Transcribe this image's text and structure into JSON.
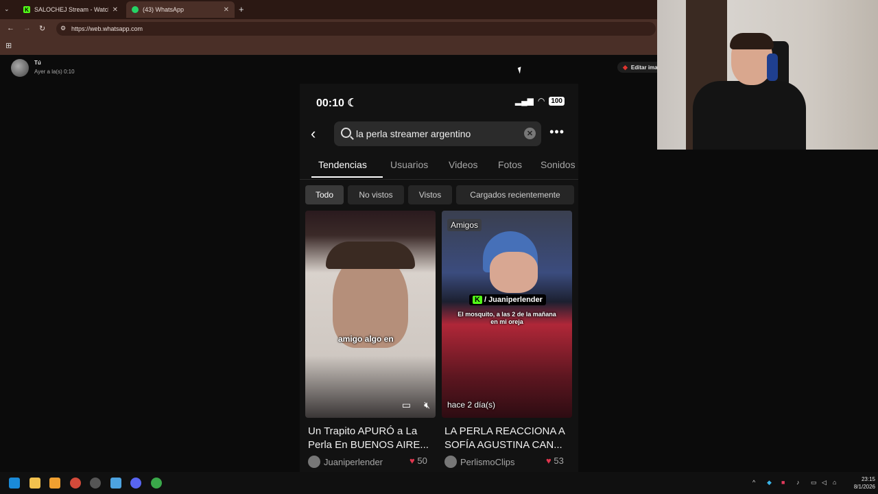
{
  "browser": {
    "tabs": [
      {
        "label": "SALOCHEJ Stream - Watch Live",
        "favicon": "kick-icon",
        "favicon_color": "#53fc18",
        "close": "✕"
      },
      {
        "label": "(43) WhatsApp",
        "favicon": "whatsapp-icon",
        "favicon_color": "#25d366",
        "close": "✕"
      }
    ],
    "new_tab": "+",
    "url": "https://web.whatsapp.com"
  },
  "viewer": {
    "sender": "Tú",
    "time": "Ayer a la(s) 0:10",
    "edit_button": "Editar ima"
  },
  "phone": {
    "clock": "00:10",
    "battery": "100",
    "search_query": "la perla streamer argentino",
    "tabs": [
      "Tendencias",
      "Usuarios",
      "Videos",
      "Fotos",
      "Sonidos"
    ],
    "active_tab": "Tendencias",
    "filters": [
      "Todo",
      "No vistos",
      "Vistos",
      "Cargados recientemente"
    ],
    "active_filter": "Todo",
    "results": [
      {
        "thumb_caption": "amigo algo en",
        "overlay_badge": "",
        "title": "Un Trapito APURÓ a La Perla En BUENOS AIRE...",
        "author": "Juaniperlender",
        "likes": "50"
      },
      {
        "thumb_caption": "El mosquito, a las 2 de la mañana en mi oreja",
        "overlay_badge": "Amigos",
        "handle": "/ Juaniperlender",
        "time_ago": "hace 2 día(s)",
        "title": "LA PERLA REACCIONA A SOFÍA AGUSTINA CAN...",
        "author": "PerlismoClips",
        "likes": "53"
      }
    ]
  },
  "taskbar": {
    "time": "23:15",
    "date": "8/1/2026"
  }
}
